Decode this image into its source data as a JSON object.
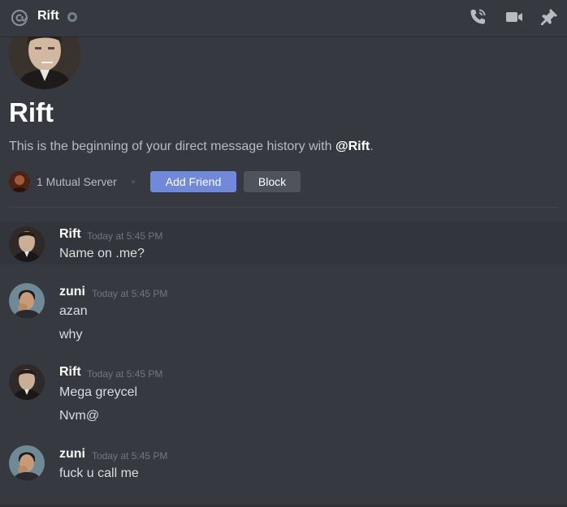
{
  "header": {
    "title": "Rift",
    "icons": [
      "at-icon",
      "status-idle-icon",
      "phone-call-icon",
      "video-call-icon",
      "pin-icon"
    ]
  },
  "intro": {
    "title": "Rift",
    "text_prefix": "This is the beginning of your direct message history with ",
    "text_mention": "@Rift",
    "text_suffix": ".",
    "mutual": "1 Mutual Server",
    "add_friend": "Add Friend",
    "block": "Block"
  },
  "messages": [
    {
      "author": "Rift",
      "time": "Today at 5:45 PM",
      "lines": [
        "Name on .me?"
      ]
    },
    {
      "author": "zuni",
      "time": "Today at 5:45 PM",
      "lines": [
        "azan",
        "why"
      ]
    },
    {
      "author": "Rift",
      "time": "Today at 5:45 PM",
      "lines": [
        "Mega greycel",
        "Nvm@"
      ]
    },
    {
      "author": "zuni",
      "time": "Today at 5:45 PM",
      "lines": [
        "fuck u call me"
      ]
    }
  ],
  "colors": {
    "background": "#36393f",
    "accent": "#7289da",
    "button_secondary": "#4f545c",
    "muted_text": "#b9bbbe",
    "timestamp": "#72767d"
  }
}
